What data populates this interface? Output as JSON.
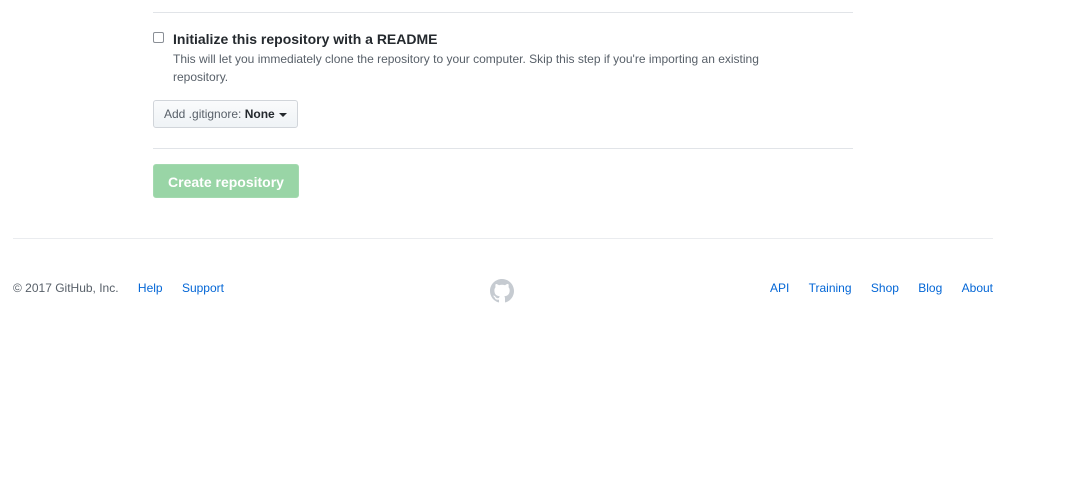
{
  "readme": {
    "checkbox_checked": false,
    "label": "Initialize this repository with a README",
    "description": "This will let you immediately clone the repository to your computer. Skip this step if you're importing an existing repository."
  },
  "gitignore": {
    "prefix": "Add .gitignore: ",
    "value": "None"
  },
  "create_button": {
    "label": "Create repository",
    "enabled": false,
    "color": "#94d3a2"
  },
  "footer": {
    "copyright": "© 2017 GitHub, Inc.",
    "left_links": [
      "Help",
      "Support"
    ],
    "logo_icon": "github-octocat-icon",
    "right_links": [
      "API",
      "Training",
      "Shop",
      "Blog",
      "About"
    ],
    "link_color": "#0366d6"
  }
}
